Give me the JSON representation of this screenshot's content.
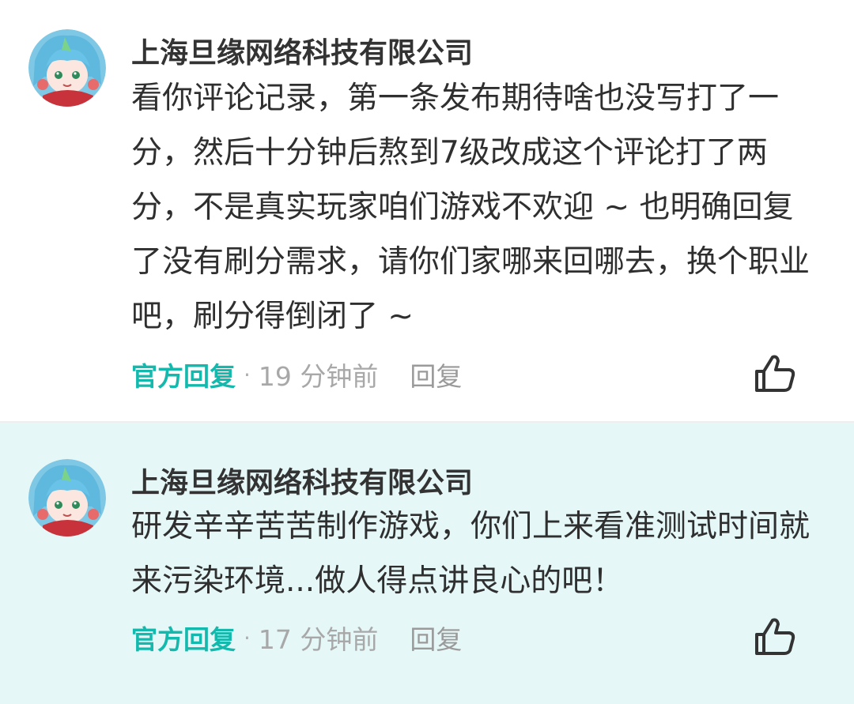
{
  "comments": [
    {
      "author": "上海旦缘网络科技有限公司",
      "text": "看你评论记录，第一条发布期待啥也没写打了一分，然后十分钟后熬到7级改成这个评论打了两分，不是真实玩家咱们游戏不欢迎 ~ 也明确回复了没有刷分需求，请你们家哪来回哪去，换个职业吧，刷分得倒闭了 ~",
      "official_label": "官方回复",
      "separator": "·",
      "time": "19 分钟前",
      "reply_label": "回复",
      "avatar_icon": "anime-avatar-icon",
      "like_icon": "thumbs-up-icon"
    },
    {
      "author": "上海旦缘网络科技有限公司",
      "text": "研发辛辛苦苦制作游戏，你们上来看准测试时间就来污染环境...做人得点讲良心的吧！",
      "official_label": "官方回复",
      "separator": "·",
      "time": "17 分钟前",
      "reply_label": "回复",
      "avatar_icon": "anime-avatar-icon",
      "like_icon": "thumbs-up-icon"
    }
  ],
  "colors": {
    "official": "#14b9ad",
    "highlight_bg": "#e5f7f7",
    "text": "#2f2f2f",
    "muted": "#a8a8a8"
  }
}
